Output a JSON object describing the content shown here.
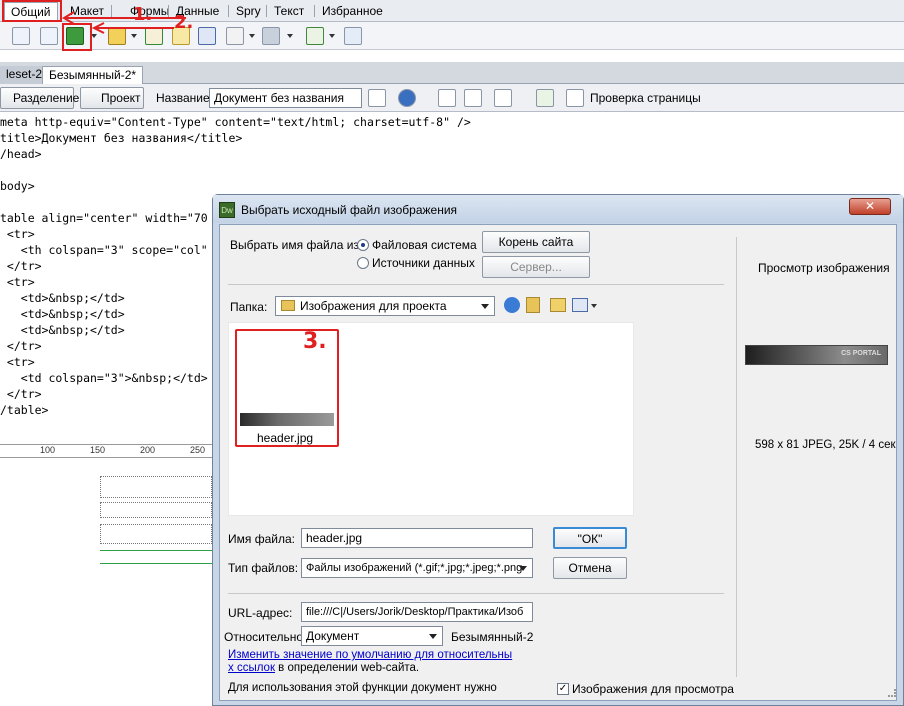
{
  "insert_tabs": [
    "Общий",
    "Макет",
    "Формы",
    "Данные",
    "Spry",
    "Текст",
    "Избранное"
  ],
  "annotations": [
    "1.",
    "2.",
    "3."
  ],
  "doc_tabs": [
    "leset-2",
    "Безымянный-2*"
  ],
  "doc_toolbar": {
    "split": "Разделение",
    "design": "Проект",
    "title_label": "Название:",
    "title_value": "Документ без названия",
    "check_page": "Проверка страницы"
  },
  "code_lines": [
    {
      "t": "meta http-equiv=\"Content-Type\" content=\"text/html; charset=utf-8\" />"
    },
    {
      "t": "title>Документ без названия</title>"
    },
    {
      "t": "/head>"
    },
    {
      "t": ""
    },
    {
      "t": "body>"
    },
    {
      "t": ""
    },
    {
      "t": "table align=\"center\" width=\"70"
    },
    {
      "t": " <tr>"
    },
    {
      "t": "   <th colspan=\"3\" scope=\"col\""
    },
    {
      "t": " </tr>"
    },
    {
      "t": " <tr>"
    },
    {
      "t": "   <td>&nbsp;</td>"
    },
    {
      "t": "   <td>&nbsp;</td>"
    },
    {
      "t": "   <td>&nbsp;</td>"
    },
    {
      "t": " </tr>"
    },
    {
      "t": " <tr>"
    },
    {
      "t": "   <td colspan=\"3\">&nbsp;</td>"
    },
    {
      "t": " </tr>"
    },
    {
      "t": "/table>"
    }
  ],
  "ruler": [
    "100",
    "150",
    "200",
    "250"
  ],
  "dialog": {
    "title": "Выбрать исходный файл изображения",
    "app_icon": "Dw",
    "select_from_label": "Выбрать имя файла из:",
    "radio_fs": "Файловая система",
    "radio_ds": "Источники данных",
    "site_root_btn": "Корень сайта",
    "server_btn": "Сервер...",
    "folder_label": "Папка:",
    "folder_value": "Изображения для проекта",
    "file_name_caption": "header.jpg",
    "file_name_label": "Имя файла:",
    "file_name_value": "header.jpg",
    "ok_btn": "\"ОК\"",
    "file_type_label": "Тип файлов:",
    "file_type_value": "Файлы изображений (*.gif;*.jpg;*.jpeg;*.png",
    "cancel_btn": "Отмена",
    "url_label": "URL-адрес:",
    "url_value": "file:///C|/Users/Jorik/Desktop/Практика/Изоб",
    "relative_label": "Относительно:",
    "relative_value": "Документ",
    "relative_doc": "Безымянный-2",
    "change_link_1": "Изменить значение по умолчанию для относительны",
    "change_link_2": "х ссылок",
    "change_tail": " в определении web-сайта.",
    "note": "Для использования этой функции документ нужно",
    "preview_chk": "Изображения для просмотра",
    "preview_title": "Просмотр изображения",
    "preview_banner": "CS PORTAL",
    "preview_info": "598 x 81 JPEG, 25K / 4 сек"
  }
}
